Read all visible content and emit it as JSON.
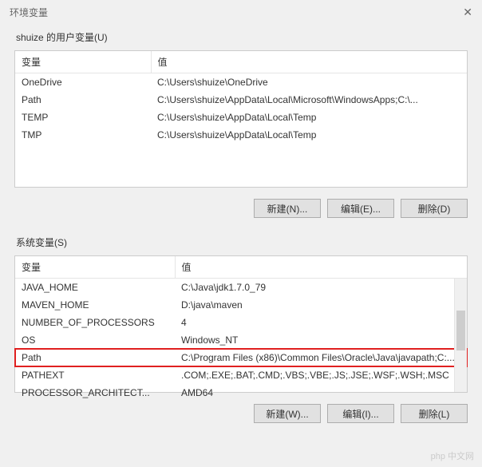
{
  "dialog": {
    "title": "环境变量"
  },
  "user_section": {
    "label": "shuize 的用户变量(U)",
    "columns": {
      "variable": "变量",
      "value": "值"
    },
    "rows": [
      {
        "variable": "OneDrive",
        "value": "C:\\Users\\shuize\\OneDrive"
      },
      {
        "variable": "Path",
        "value": "C:\\Users\\shuize\\AppData\\Local\\Microsoft\\WindowsApps;C:\\..."
      },
      {
        "variable": "TEMP",
        "value": "C:\\Users\\shuize\\AppData\\Local\\Temp"
      },
      {
        "variable": "TMP",
        "value": "C:\\Users\\shuize\\AppData\\Local\\Temp"
      }
    ],
    "buttons": {
      "new": "新建(N)...",
      "edit": "编辑(E)...",
      "delete": "删除(D)"
    }
  },
  "system_section": {
    "label": "系统变量(S)",
    "columns": {
      "variable": "变量",
      "value": "值"
    },
    "rows": [
      {
        "variable": "JAVA_HOME",
        "value": "C:\\Java\\jdk1.7.0_79"
      },
      {
        "variable": "MAVEN_HOME",
        "value": "D:\\java\\maven"
      },
      {
        "variable": "NUMBER_OF_PROCESSORS",
        "value": "4"
      },
      {
        "variable": "OS",
        "value": "Windows_NT"
      },
      {
        "variable": "Path",
        "value": "C:\\Program Files (x86)\\Common Files\\Oracle\\Java\\javapath;C:..."
      },
      {
        "variable": "PATHEXT",
        "value": ".COM;.EXE;.BAT;.CMD;.VBS;.VBE;.JS;.JSE;.WSF;.WSH;.MSC"
      },
      {
        "variable": "PROCESSOR_ARCHITECT...",
        "value": "AMD64"
      }
    ],
    "highlighted_index": 4,
    "buttons": {
      "new": "新建(W)...",
      "edit": "编辑(I)...",
      "delete": "删除(L)"
    }
  },
  "watermark": "php 中文网"
}
